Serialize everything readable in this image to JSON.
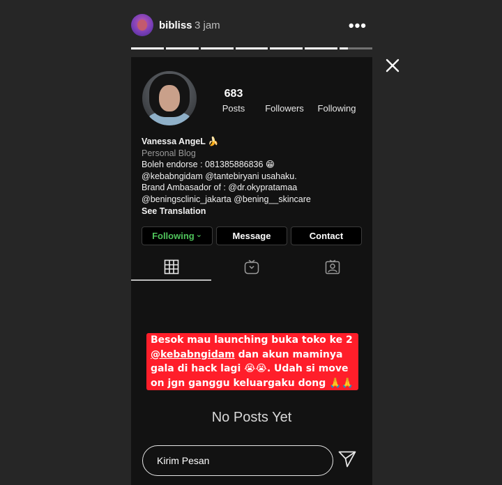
{
  "story_header": {
    "username": "bibliss",
    "time": "3 jam",
    "more_label": "•••"
  },
  "progress": {
    "segments": 7,
    "active_index": 6,
    "active_fraction": 0.25
  },
  "profile": {
    "stats": [
      {
        "value": "683",
        "label": "Posts"
      },
      {
        "value": "",
        "label": "Followers"
      },
      {
        "value": "",
        "label": "Following"
      }
    ],
    "name": "Vanessa AngeL 🍌",
    "category": "Personal Blog",
    "bio_lines": [
      "Boleh endorse : 081385886836 😁",
      "@kebabngidam @tantebiryani usahaku.",
      "Brand Ambasador of : @dr.okypratamaa",
      "@beningsclinic_jakarta @bening__skincare"
    ],
    "see_translation": "See Translation",
    "buttons": {
      "following": "Following",
      "following_icon": "⌄",
      "message": "Message",
      "contact": "Contact"
    },
    "tabs": [
      {
        "name": "grid-icon",
        "active": true
      },
      {
        "name": "igtv-icon",
        "active": false
      },
      {
        "name": "tagged-icon",
        "active": false
      }
    ],
    "empty_text": "No Posts Yet"
  },
  "sticker": {
    "line1": "Besok mau launching buka toko ke 2",
    "mention": "@kebabngidam",
    "line2_rest": " dan akun maminya",
    "line3": "gala di hack lagi 😭😭. Udah si move",
    "line4": "on jgn ganggu keluargaku dong 🙏🙏",
    "background": "#ff1e2a"
  },
  "reply": {
    "placeholder": "Kirim Pesan"
  },
  "colors": {
    "page_bg": "#262626",
    "story_bg": "#121212",
    "following_green": "#4fc45b"
  }
}
